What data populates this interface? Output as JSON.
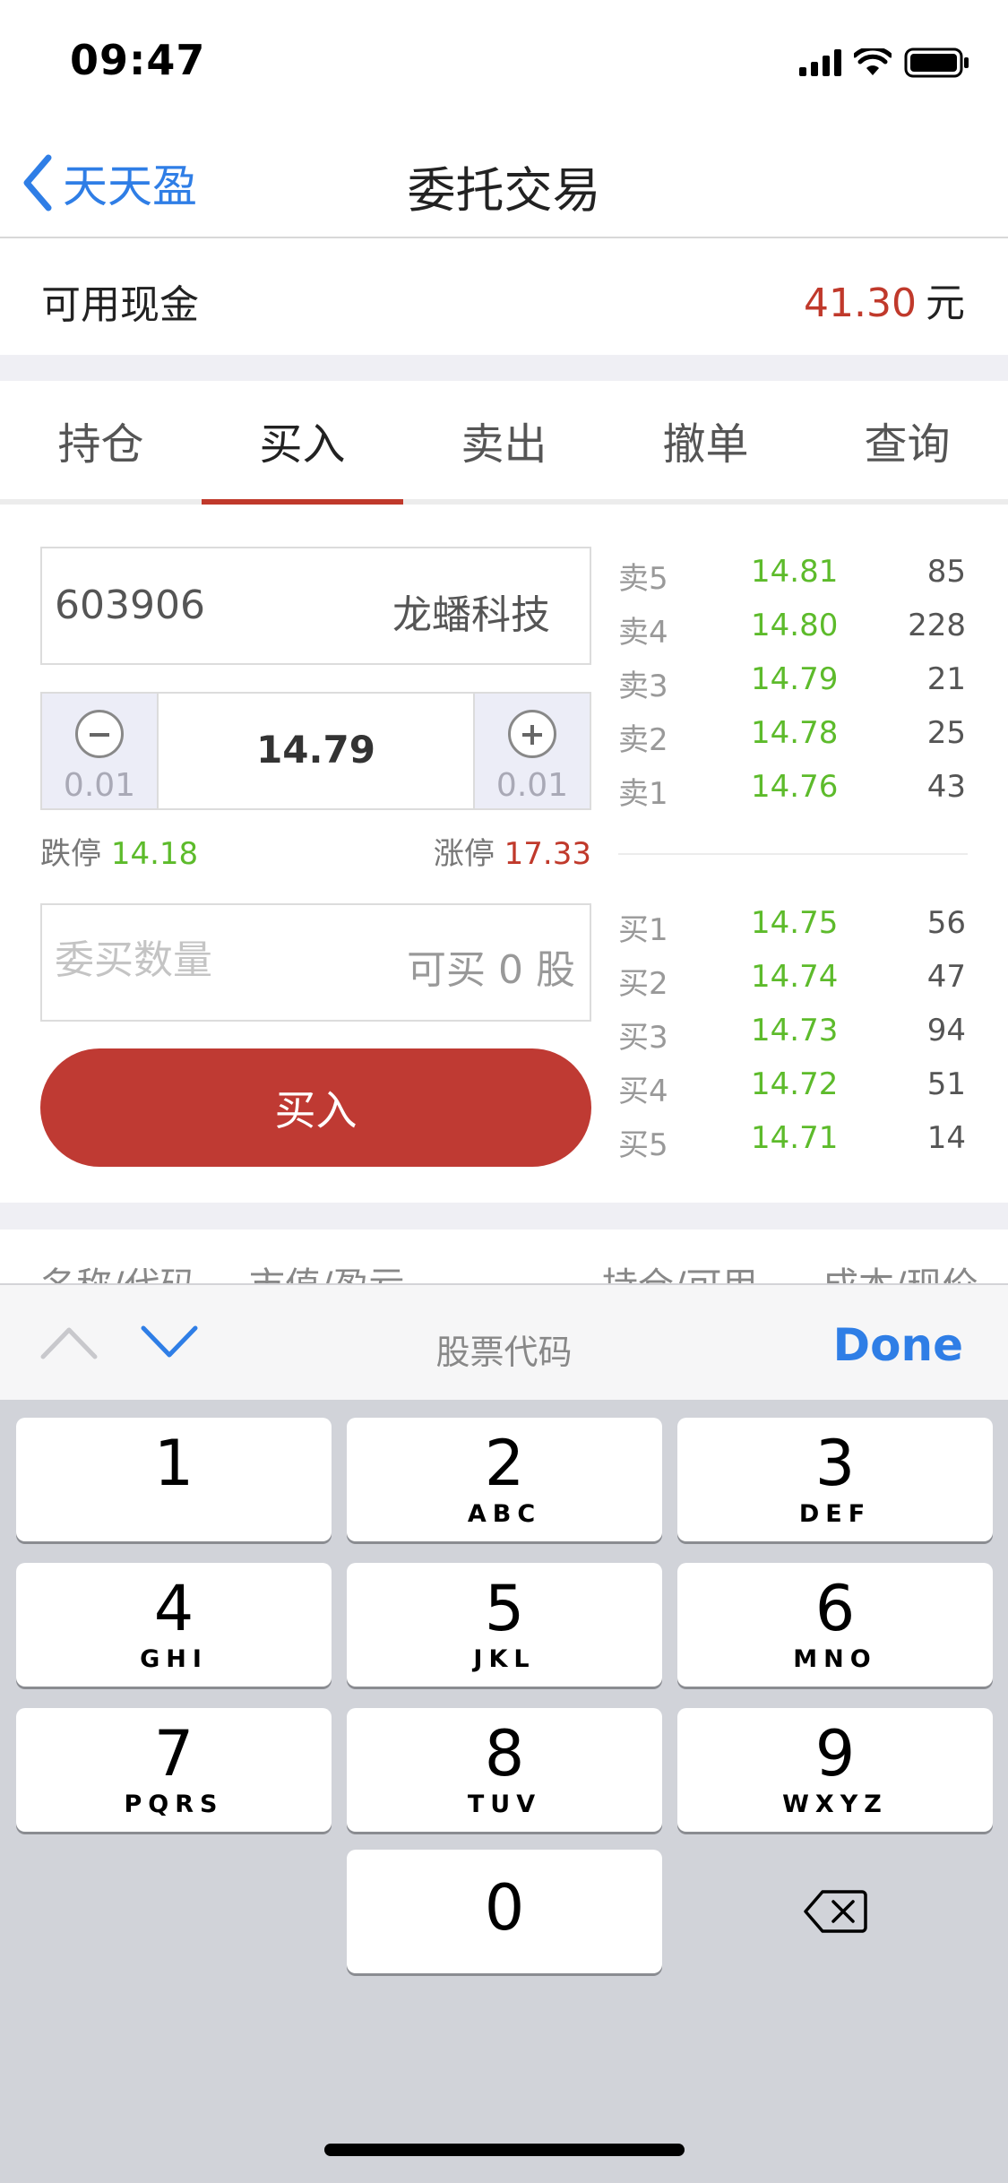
{
  "status_bar": {
    "time": "09:47"
  },
  "nav": {
    "back_label": "天天盈",
    "title": "委托交易"
  },
  "cash": {
    "label": "可用现金",
    "value": "41.30",
    "unit": "元"
  },
  "tabs": [
    {
      "label": "持仓",
      "active": false
    },
    {
      "label": "买入",
      "active": true
    },
    {
      "label": "卖出",
      "active": false
    },
    {
      "label": "撤单",
      "active": false
    },
    {
      "label": "查询",
      "active": false
    }
  ],
  "order_form": {
    "stock_code": "603906",
    "stock_name": "龙蟠科技",
    "price": "14.79",
    "step_down": "0.01",
    "step_up": "0.01",
    "limit_down_label": "跌停",
    "limit_down_value": "14.18",
    "limit_up_label": "涨停",
    "limit_up_value": "17.33",
    "quantity_placeholder": "委买数量",
    "available_label": "可买 0 股",
    "buy_button": "买入"
  },
  "order_book": {
    "sell": [
      {
        "label": "卖5",
        "price": "14.81",
        "volume": "85"
      },
      {
        "label": "卖4",
        "price": "14.80",
        "volume": "228"
      },
      {
        "label": "卖3",
        "price": "14.79",
        "volume": "21"
      },
      {
        "label": "卖2",
        "price": "14.78",
        "volume": "25"
      },
      {
        "label": "卖1",
        "price": "14.76",
        "volume": "43"
      }
    ],
    "buy": [
      {
        "label": "买1",
        "price": "14.75",
        "volume": "56"
      },
      {
        "label": "买2",
        "price": "14.74",
        "volume": "47"
      },
      {
        "label": "买3",
        "price": "14.73",
        "volume": "94"
      },
      {
        "label": "买4",
        "price": "14.72",
        "volume": "51"
      },
      {
        "label": "买5",
        "price": "14.71",
        "volume": "14"
      }
    ]
  },
  "holdings_header": {
    "columns": [
      "名称/代码",
      "市值/盈亏",
      "持仓/可用",
      "成本/现价"
    ]
  },
  "keyboard_accessory": {
    "title": "股票代码",
    "done": "Done"
  },
  "keypad": {
    "keys": [
      {
        "digit": "1",
        "letters": ""
      },
      {
        "digit": "2",
        "letters": "ABC"
      },
      {
        "digit": "3",
        "letters": "DEF"
      },
      {
        "digit": "4",
        "letters": "GHI"
      },
      {
        "digit": "5",
        "letters": "JKL"
      },
      {
        "digit": "6",
        "letters": "MNO"
      },
      {
        "digit": "7",
        "letters": "PQRS"
      },
      {
        "digit": "8",
        "letters": "TUV"
      },
      {
        "digit": "9",
        "letters": "WXYZ"
      },
      {
        "digit": "0",
        "letters": ""
      }
    ]
  },
  "colors": {
    "accent": "#2f7ee6",
    "buy_red": "#bf3a33",
    "price_green": "#5dbb2b"
  }
}
